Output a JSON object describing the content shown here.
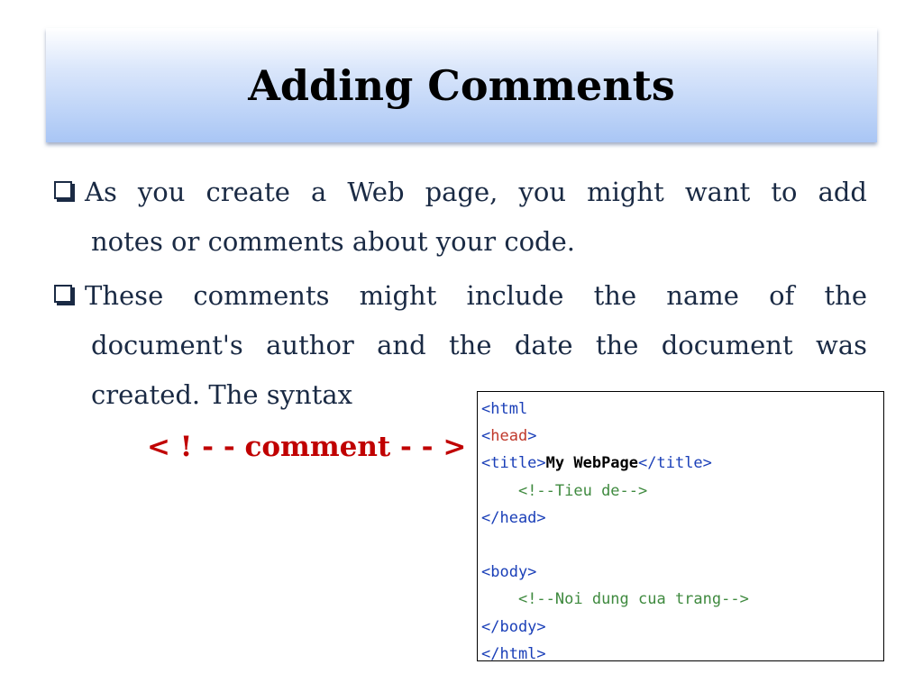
{
  "title": "Adding Comments",
  "bullets": [
    {
      "line1": "As you create a Web page, you might want to add",
      "line2": "notes or comments about your code."
    },
    {
      "line1": "These comments might include the name of the",
      "line2": "document's author and the date the document was",
      "line3": "created. The syntax"
    }
  ],
  "syntax": "< ! - - comment - - >",
  "code": {
    "l1": "<html",
    "l2_lt": "<",
    "l2_head": "head",
    "l2_gt": ">",
    "l3_open": "<title>",
    "l3_text": "My WebPage",
    "l3_close": "</title>",
    "l4_indent": "    ",
    "l4_comment": "<!--Tieu de-->",
    "l5": "</head>",
    "l6": "",
    "l7": "<body>",
    "l8_indent": "    ",
    "l8_comment": "<!--Noi dung cua trang-->",
    "l9": "</body>",
    "l10": "</html>"
  }
}
